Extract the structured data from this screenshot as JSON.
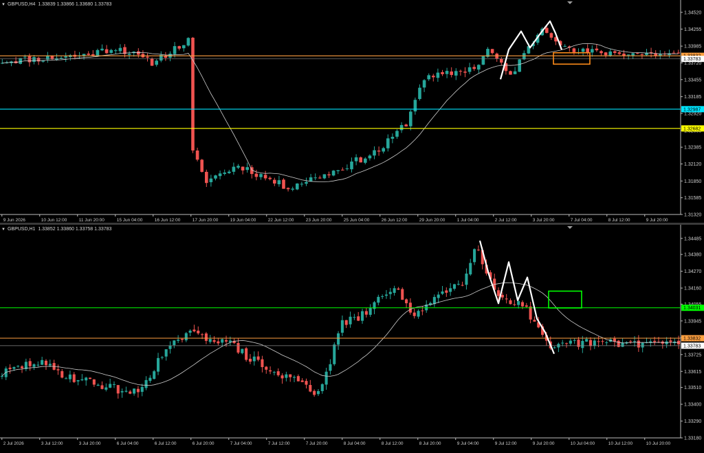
{
  "colors": {
    "bull": "#26a69a",
    "bear": "#ef5350",
    "ma": "#cfcfcf",
    "axis": "#bdbdbd",
    "grid_text": "#cfcfcf"
  },
  "icons": {
    "collapse": "triangle-down-icon",
    "scroll_marker": "triangle-down-icon"
  },
  "chart_data": [
    {
      "type": "candlestick",
      "symbol": "GBPUSD",
      "timeframe": "H4",
      "header": {
        "symbol_tf": "GBPUSD,H4",
        "open": "1.33839",
        "high": "1.33866",
        "low": "1.33680",
        "close": "1.33783"
      },
      "y_ticks": [
        "1.34520",
        "1.34255",
        "1.33985",
        "1.33720",
        "1.33455",
        "1.33185",
        "1.32920",
        "1.32650",
        "1.32385",
        "1.32120",
        "1.31850",
        "1.31585",
        "1.31320"
      ],
      "ylim": [
        1.3132,
        1.3465
      ],
      "x_ticks": [
        "9 Jun 2026",
        "10 Jun 12:00",
        "11 Jun 20:00",
        "15 Jun 04:00",
        "16 Jun 12:00",
        "17 Jun 20:00",
        "19 Jun 04:00",
        "22 Jun 12:00",
        "23 Jun 20:00",
        "25 Jun 04:00",
        "26 Jun 12:00",
        "29 Jun 20:00",
        "1 Jul 04:00",
        "2 Jul 12:00",
        "3 Jul 20:00",
        "7 Jul 04:00",
        "8 Jul 12:00",
        "9 Jul 20:00"
      ],
      "h_lines": [
        {
          "label": "1.33832",
          "value": 1.33832,
          "color": "#ffa040"
        },
        {
          "label": "1.33783",
          "value": 1.33783,
          "color": "#ffffff"
        },
        {
          "label": "1.32987",
          "value": 1.32987,
          "color": "#00e5ff"
        },
        {
          "label": "1.32682",
          "value": 1.32682,
          "color": "#ffff00"
        }
      ],
      "annotation_box_color": "#ff8c1a",
      "pattern_color": "#ffffff"
    },
    {
      "type": "candlestick",
      "symbol": "GBPUSD",
      "timeframe": "H1",
      "header": {
        "symbol_tf": "GBPUSD,H1",
        "open": "1.33852",
        "high": "1.33860",
        "low": "1.33758",
        "close": "1.33783"
      },
      "y_ticks": [
        "1.34485",
        "1.34380",
        "1.34270",
        "1.34160",
        "1.34055",
        "1.33945",
        "1.33835",
        "1.33725",
        "1.33615",
        "1.33510",
        "1.33400",
        "1.33290",
        "1.33180"
      ],
      "ylim": [
        1.3318,
        1.3452
      ],
      "x_ticks": [
        "2 Jul 2026",
        "3 Jul 12:00",
        "3 Jul 20:00",
        "6 Jul 04:00",
        "6 Jul 12:00",
        "6 Jul 20:00",
        "7 Jul 04:00",
        "7 Jul 12:00",
        "7 Jul 20:00",
        "8 Jul 04:00",
        "8 Jul 12:00",
        "8 Jul 20:00",
        "9 Jul 04:00",
        "9 Jul 12:00",
        "9 Jul 20:00",
        "10 Jul 04:00",
        "10 Jul 12:00",
        "10 Jul 20:00"
      ],
      "h_lines": [
        {
          "label": "1.34031",
          "value": 1.34031,
          "color": "#00ff00"
        },
        {
          "label": "1.33832",
          "value": 1.33832,
          "color": "#ffa040"
        },
        {
          "label": "1.33783",
          "value": 1.33783,
          "color": "#ffffff"
        }
      ],
      "annotation_box_color": "#00ff00",
      "pattern_color": "#ffffff"
    }
  ]
}
